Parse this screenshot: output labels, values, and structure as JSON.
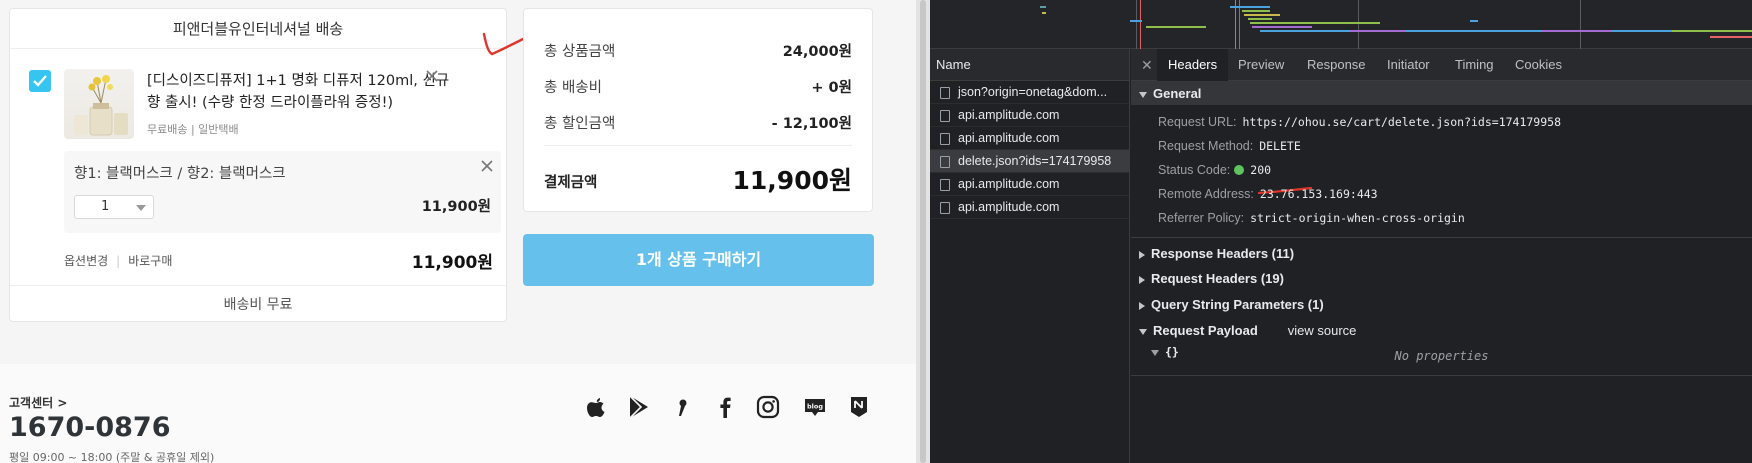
{
  "shop": {
    "seller_name": "피앤더블유인터네셔널 배송",
    "product": {
      "name": "[디스이즈디퓨저] 1+1 명화 디퓨저 120ml, 신규향 출시! (수량 한정 드라이플라워 증정!)",
      "shipping_meta": "무료배송 | 일반택배",
      "option_label": "향1: 블랙머스크 / 향2: 블랙머스크",
      "quantity": "1",
      "option_price": "11,900원",
      "links": {
        "change_option": "옵션변경",
        "buy_now": "바로구매"
      },
      "row_total": "11,900원"
    },
    "shipping_fee_text": "배송비 무료",
    "summary": {
      "rows": [
        {
          "label": "총 상품금액",
          "value": "24,000원"
        },
        {
          "label": "총 배송비",
          "value": "+ 0원"
        },
        {
          "label": "총 할인금액",
          "value": "- 12,100원"
        }
      ],
      "pay_label": "결제금액",
      "pay_value": "11,900원"
    },
    "buy_button": "1개 상품 구매하기",
    "footer": {
      "cs_link": "고객센터 >",
      "phone": "1670-0876",
      "hours": "평일 09:00 ~ 18:00 (주말 & 공휴일 제외)",
      "social_icons": [
        "apple-icon",
        "google-play-icon",
        "kakao-story-icon",
        "facebook-icon",
        "instagram-icon",
        "blog-icon",
        "naver-post-icon"
      ]
    },
    "colors": {
      "accent": "#35c5f0",
      "buy_button": "#65c1ec",
      "annotation_red": "#e0352b"
    }
  },
  "devtools": {
    "name_header": "Name",
    "requests": [
      {
        "name": "json?origin=onetag&dom..."
      },
      {
        "name": "api.amplitude.com"
      },
      {
        "name": "api.amplitude.com"
      },
      {
        "name": "delete.json?ids=174179958",
        "selected": true
      },
      {
        "name": "api.amplitude.com"
      },
      {
        "name": "api.amplitude.com"
      }
    ],
    "tabs": [
      "Headers",
      "Preview",
      "Response",
      "Initiator",
      "Timing",
      "Cookies"
    ],
    "active_tab": "Headers",
    "general": {
      "title": "General",
      "request_url_label": "Request URL:",
      "request_url": "https://ohou.se/cart/delete.json?ids=174179958",
      "method_label": "Request Method:",
      "method": "DELETE",
      "status_label": "Status Code:",
      "status": "200",
      "remote_label": "Remote Address:",
      "remote": "23.76.153.169:443",
      "referrer_label": "Referrer Policy:",
      "referrer": "strict-origin-when-cross-origin"
    },
    "sections": {
      "response_headers": "Response Headers (11)",
      "request_headers": "Request Headers (19)",
      "query_params": "Query String Parameters (1)",
      "payload": "Request Payload",
      "view_source": "view source",
      "payload_root": "{}",
      "no_properties": "No properties"
    }
  }
}
